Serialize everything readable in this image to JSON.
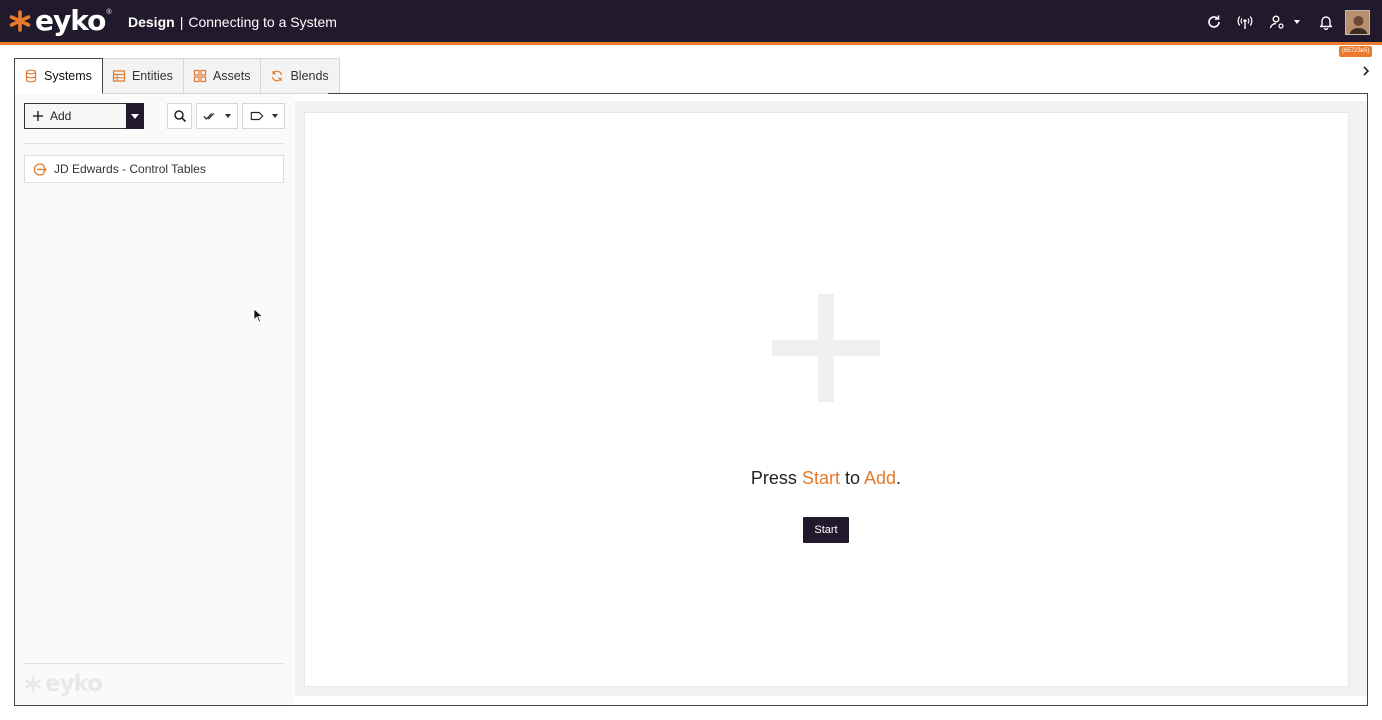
{
  "header": {
    "brand": "eyko",
    "brand_mark": "®",
    "section": "Design",
    "separator": "|",
    "page": "Connecting to a System",
    "icons": [
      "refresh-icon",
      "broadcast-icon",
      "user-settings-icon",
      "bell-icon"
    ],
    "version": "(65723e5)"
  },
  "tabs": [
    {
      "label": "Systems",
      "icon": "database-icon",
      "active": true
    },
    {
      "label": "Entities",
      "icon": "table-icon",
      "active": false
    },
    {
      "label": "Assets",
      "icon": "grid-icon",
      "active": false
    },
    {
      "label": "Blends",
      "icon": "sync-icon",
      "active": false
    }
  ],
  "toolbar": {
    "add_label": "Add",
    "search_icon": "search-icon",
    "check_icon": "double-check-icon",
    "tag_icon": "tag-icon"
  },
  "systems": [
    {
      "label": "JD Edwards - Control Tables",
      "icon": "system-connector-icon"
    }
  ],
  "footer": {
    "brand": "eyko"
  },
  "main": {
    "prompt_press": "Press",
    "prompt_start": "Start",
    "prompt_to": "to",
    "prompt_add": "Add",
    "prompt_end": ".",
    "start_button": "Start"
  },
  "colors": {
    "header_bg": "#201a2c",
    "accent": "#ec7a2c",
    "button_dark": "#201a2c"
  }
}
